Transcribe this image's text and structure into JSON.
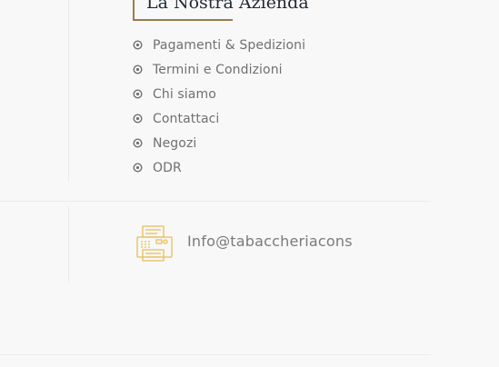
{
  "section": {
    "heading": "La Nostra Azienda",
    "accent_color": "#9b7c4a",
    "links": [
      {
        "label": "Pagamenti & Spedizioni",
        "icon": "circle-dot-icon"
      },
      {
        "label": "Termini e Condizioni",
        "icon": "circle-dot-icon"
      },
      {
        "label": "Chi siamo",
        "icon": "circle-dot-icon"
      },
      {
        "label": "Contattaci",
        "icon": "circle-dot-icon"
      },
      {
        "label": "Negozi",
        "icon": "circle-dot-icon"
      },
      {
        "label": "ODR",
        "icon": "circle-dot-icon"
      }
    ]
  },
  "contact": {
    "icon": "fax-icon",
    "icon_color": "#e9bd57",
    "email": "Info@tabaccheriacons"
  }
}
